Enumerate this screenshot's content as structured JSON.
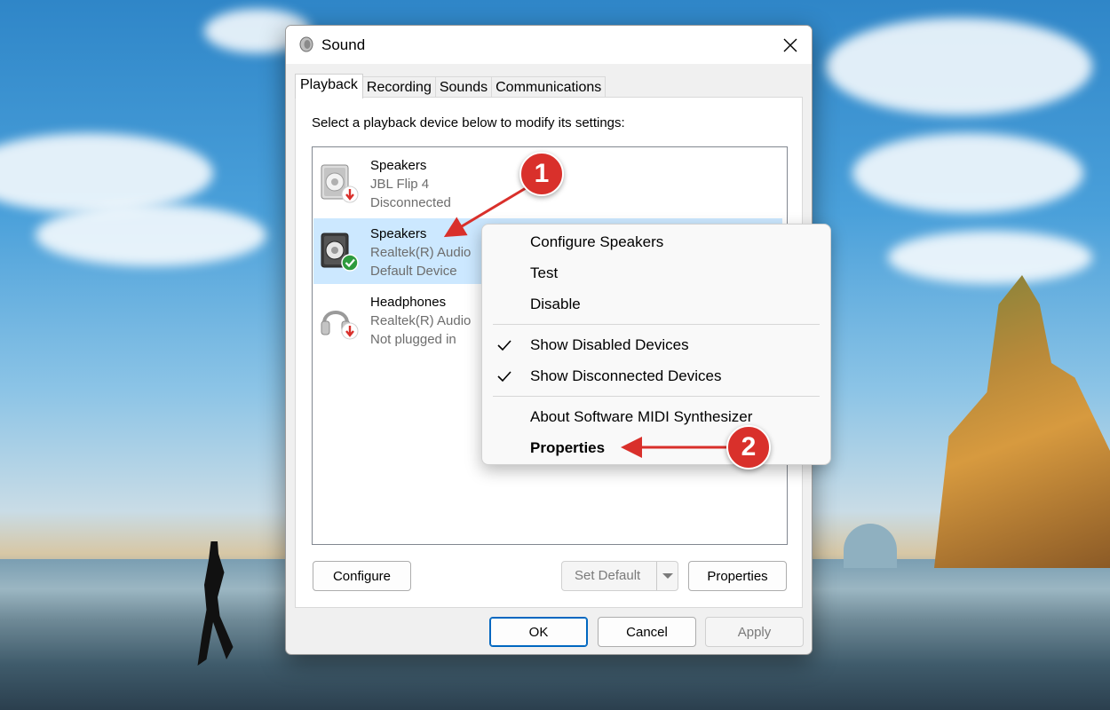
{
  "window": {
    "title": "Sound",
    "tabs": [
      {
        "label": "Playback",
        "active": true
      },
      {
        "label": "Recording",
        "active": false
      },
      {
        "label": "Sounds",
        "active": false
      },
      {
        "label": "Communications",
        "active": false
      }
    ]
  },
  "playback": {
    "instructions": "Select a playback device below to modify its settings:",
    "devices": [
      {
        "name": "Speakers",
        "description": "JBL Flip 4",
        "status": "Disconnected",
        "icon": "speaker-icon",
        "state_icon": "red-down-arrow-icon",
        "selected": false
      },
      {
        "name": "Speakers",
        "description": "Realtek(R) Audio",
        "status": "Default Device",
        "icon": "speaker-icon",
        "state_icon": "green-check-icon",
        "selected": true
      },
      {
        "name": "Headphones",
        "description": "Realtek(R) Audio",
        "status": "Not plugged in",
        "icon": "headphones-icon",
        "state_icon": "red-down-arrow-icon",
        "selected": false
      }
    ],
    "buttons": {
      "configure": "Configure",
      "set_default": "Set Default",
      "properties": "Properties"
    }
  },
  "footer": {
    "ok": "OK",
    "cancel": "Cancel",
    "apply": "Apply"
  },
  "context_menu": {
    "items": [
      {
        "label": "Configure Speakers",
        "checked": false,
        "bold": false
      },
      {
        "label": "Test",
        "checked": false,
        "bold": false
      },
      {
        "label": "Disable",
        "checked": false,
        "bold": false
      },
      {
        "label": "Show Disabled Devices",
        "checked": true,
        "bold": false
      },
      {
        "label": "Show Disconnected Devices",
        "checked": true,
        "bold": false
      },
      {
        "label": "About Software MIDI Synthesizer",
        "checked": false,
        "bold": false
      },
      {
        "label": "Properties",
        "checked": false,
        "bold": true
      }
    ]
  },
  "annotations": {
    "step1": "1",
    "step2": "2",
    "color": "#d9302b"
  },
  "colors": {
    "selection": "#cce8ff",
    "accent": "#0067c0"
  }
}
